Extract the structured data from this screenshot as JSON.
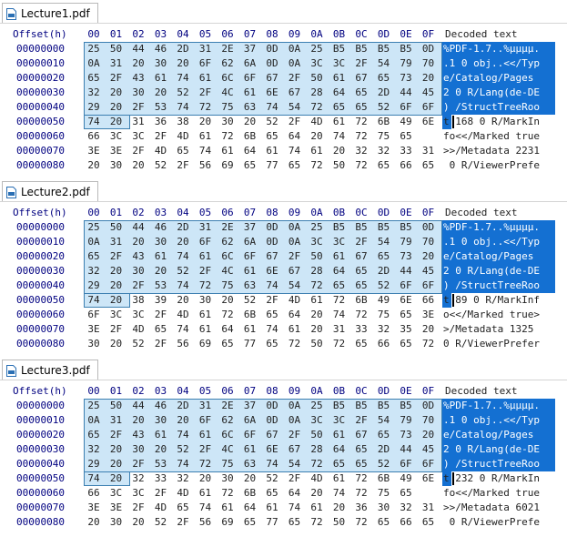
{
  "header": {
    "offset": "Offset(h)",
    "columns": [
      "00",
      "01",
      "02",
      "03",
      "04",
      "05",
      "06",
      "07",
      "08",
      "09",
      "0A",
      "0B",
      "0C",
      "0D",
      "0E",
      "0F"
    ],
    "decoded": "Decoded text"
  },
  "panes": [
    {
      "tab": "Lecture1.pdf",
      "rows": [
        {
          "offset": "00000000",
          "hex": [
            "25",
            "50",
            "44",
            "46",
            "2D",
            "31",
            "2E",
            "37",
            "0D",
            "0A",
            "25",
            "B5",
            "B5",
            "B5",
            "B5",
            "0D"
          ],
          "text": "%PDF-1.7..%µµµµ."
        },
        {
          "offset": "00000010",
          "hex": [
            "0A",
            "31",
            "20",
            "30",
            "20",
            "6F",
            "62",
            "6A",
            "0D",
            "0A",
            "3C",
            "3C",
            "2F",
            "54",
            "79",
            "70"
          ],
          "text": ".1 0 obj..<</Typ"
        },
        {
          "offset": "00000020",
          "hex": [
            "65",
            "2F",
            "43",
            "61",
            "74",
            "61",
            "6C",
            "6F",
            "67",
            "2F",
            "50",
            "61",
            "67",
            "65",
            "73",
            "20"
          ],
          "text": "e/Catalog/Pages "
        },
        {
          "offset": "00000030",
          "hex": [
            "32",
            "20",
            "30",
            "20",
            "52",
            "2F",
            "4C",
            "61",
            "6E",
            "67",
            "28",
            "64",
            "65",
            "2D",
            "44",
            "45"
          ],
          "text": "2 0 R/Lang(de-DE"
        },
        {
          "offset": "00000040",
          "hex": [
            "29",
            "20",
            "2F",
            "53",
            "74",
            "72",
            "75",
            "63",
            "74",
            "54",
            "72",
            "65",
            "65",
            "52",
            "6F",
            "6F"
          ],
          "text": ") /StructTreeRoo"
        },
        {
          "offset": "00000050",
          "hex": [
            "74",
            "20",
            "31",
            "36",
            "38",
            "20",
            "30",
            "20",
            "52",
            "2F",
            "4D",
            "61",
            "72",
            "6B",
            "49",
            "6E"
          ],
          "text": "t 168 0 R/MarkIn"
        },
        {
          "offset": "00000060",
          "hex": [
            "66",
            "3C",
            "3C",
            "2F",
            "4D",
            "61",
            "72",
            "6B",
            "65",
            "64",
            "20",
            "74",
            "72",
            "75",
            "65",
            ""
          ],
          "text": "fo<</Marked true"
        },
        {
          "offset": "00000070",
          "hex": [
            "3E",
            "3E",
            "2F",
            "4D",
            "65",
            "74",
            "61",
            "64",
            "61",
            "74",
            "61",
            "20",
            "32",
            "32",
            "33",
            "31"
          ],
          "text": ">>/Metadata 2231"
        },
        {
          "offset": "00000080",
          "hex": [
            "20",
            "30",
            "20",
            "52",
            "2F",
            "56",
            "69",
            "65",
            "77",
            "65",
            "72",
            "50",
            "72",
            "65",
            "66",
            "65"
          ],
          "text": " 0 R/ViewerPrefe"
        }
      ]
    },
    {
      "tab": "Lecture2.pdf",
      "rows": [
        {
          "offset": "00000000",
          "hex": [
            "25",
            "50",
            "44",
            "46",
            "2D",
            "31",
            "2E",
            "37",
            "0D",
            "0A",
            "25",
            "B5",
            "B5",
            "B5",
            "B5",
            "0D"
          ],
          "text": "%PDF-1.7..%µµµµ."
        },
        {
          "offset": "00000010",
          "hex": [
            "0A",
            "31",
            "20",
            "30",
            "20",
            "6F",
            "62",
            "6A",
            "0D",
            "0A",
            "3C",
            "3C",
            "2F",
            "54",
            "79",
            "70"
          ],
          "text": ".1 0 obj..<</Typ"
        },
        {
          "offset": "00000020",
          "hex": [
            "65",
            "2F",
            "43",
            "61",
            "74",
            "61",
            "6C",
            "6F",
            "67",
            "2F",
            "50",
            "61",
            "67",
            "65",
            "73",
            "20"
          ],
          "text": "e/Catalog/Pages "
        },
        {
          "offset": "00000030",
          "hex": [
            "32",
            "20",
            "30",
            "20",
            "52",
            "2F",
            "4C",
            "61",
            "6E",
            "67",
            "28",
            "64",
            "65",
            "2D",
            "44",
            "45"
          ],
          "text": "2 0 R/Lang(de-DE"
        },
        {
          "offset": "00000040",
          "hex": [
            "29",
            "20",
            "2F",
            "53",
            "74",
            "72",
            "75",
            "63",
            "74",
            "54",
            "72",
            "65",
            "65",
            "52",
            "6F",
            "6F"
          ],
          "text": ") /StructTreeRoo"
        },
        {
          "offset": "00000050",
          "hex": [
            "74",
            "20",
            "38",
            "39",
            "20",
            "30",
            "20",
            "52",
            "2F",
            "4D",
            "61",
            "72",
            "6B",
            "49",
            "6E",
            "66"
          ],
          "text": "t 89 0 R/MarkInf"
        },
        {
          "offset": "00000060",
          "hex": [
            "6F",
            "3C",
            "3C",
            "2F",
            "4D",
            "61",
            "72",
            "6B",
            "65",
            "64",
            "20",
            "74",
            "72",
            "75",
            "65",
            "3E"
          ],
          "text": "o<</Marked true>"
        },
        {
          "offset": "00000070",
          "hex": [
            "3E",
            "2F",
            "4D",
            "65",
            "74",
            "61",
            "64",
            "61",
            "74",
            "61",
            "20",
            "31",
            "33",
            "32",
            "35",
            "20"
          ],
          "text": ">/Metadata 1325 "
        },
        {
          "offset": "00000080",
          "hex": [
            "30",
            "20",
            "52",
            "2F",
            "56",
            "69",
            "65",
            "77",
            "65",
            "72",
            "50",
            "72",
            "65",
            "66",
            "65",
            "72"
          ],
          "text": "0 R/ViewerPrefer"
        }
      ]
    },
    {
      "tab": "Lecture3.pdf",
      "rows": [
        {
          "offset": "00000000",
          "hex": [
            "25",
            "50",
            "44",
            "46",
            "2D",
            "31",
            "2E",
            "37",
            "0D",
            "0A",
            "25",
            "B5",
            "B5",
            "B5",
            "B5",
            "0D"
          ],
          "text": "%PDF-1.7..%µµµµ."
        },
        {
          "offset": "00000010",
          "hex": [
            "0A",
            "31",
            "20",
            "30",
            "20",
            "6F",
            "62",
            "6A",
            "0D",
            "0A",
            "3C",
            "3C",
            "2F",
            "54",
            "79",
            "70"
          ],
          "text": ".1 0 obj..<</Typ"
        },
        {
          "offset": "00000020",
          "hex": [
            "65",
            "2F",
            "43",
            "61",
            "74",
            "61",
            "6C",
            "6F",
            "67",
            "2F",
            "50",
            "61",
            "67",
            "65",
            "73",
            "20"
          ],
          "text": "e/Catalog/Pages "
        },
        {
          "offset": "00000030",
          "hex": [
            "32",
            "20",
            "30",
            "20",
            "52",
            "2F",
            "4C",
            "61",
            "6E",
            "67",
            "28",
            "64",
            "65",
            "2D",
            "44",
            "45"
          ],
          "text": "2 0 R/Lang(de-DE"
        },
        {
          "offset": "00000040",
          "hex": [
            "29",
            "20",
            "2F",
            "53",
            "74",
            "72",
            "75",
            "63",
            "74",
            "54",
            "72",
            "65",
            "65",
            "52",
            "6F",
            "6F"
          ],
          "text": ") /StructTreeRoo"
        },
        {
          "offset": "00000050",
          "hex": [
            "74",
            "20",
            "32",
            "33",
            "32",
            "20",
            "30",
            "20",
            "52",
            "2F",
            "4D",
            "61",
            "72",
            "6B",
            "49",
            "6E"
          ],
          "text": "t 232 0 R/MarkIn"
        },
        {
          "offset": "00000060",
          "hex": [
            "66",
            "3C",
            "3C",
            "2F",
            "4D",
            "61",
            "72",
            "6B",
            "65",
            "64",
            "20",
            "74",
            "72",
            "75",
            "65",
            ""
          ],
          "text": "fo<</Marked true"
        },
        {
          "offset": "00000070",
          "hex": [
            "3E",
            "3E",
            "2F",
            "4D",
            "65",
            "74",
            "61",
            "64",
            "61",
            "74",
            "61",
            "20",
            "36",
            "30",
            "32",
            "31"
          ],
          "text": ">>/Metadata 6021"
        },
        {
          "offset": "00000080",
          "hex": [
            "20",
            "30",
            "20",
            "52",
            "2F",
            "56",
            "69",
            "65",
            "77",
            "65",
            "72",
            "50",
            "72",
            "65",
            "66",
            "65"
          ],
          "text": " 0 R/ViewerPrefe"
        }
      ]
    }
  ]
}
